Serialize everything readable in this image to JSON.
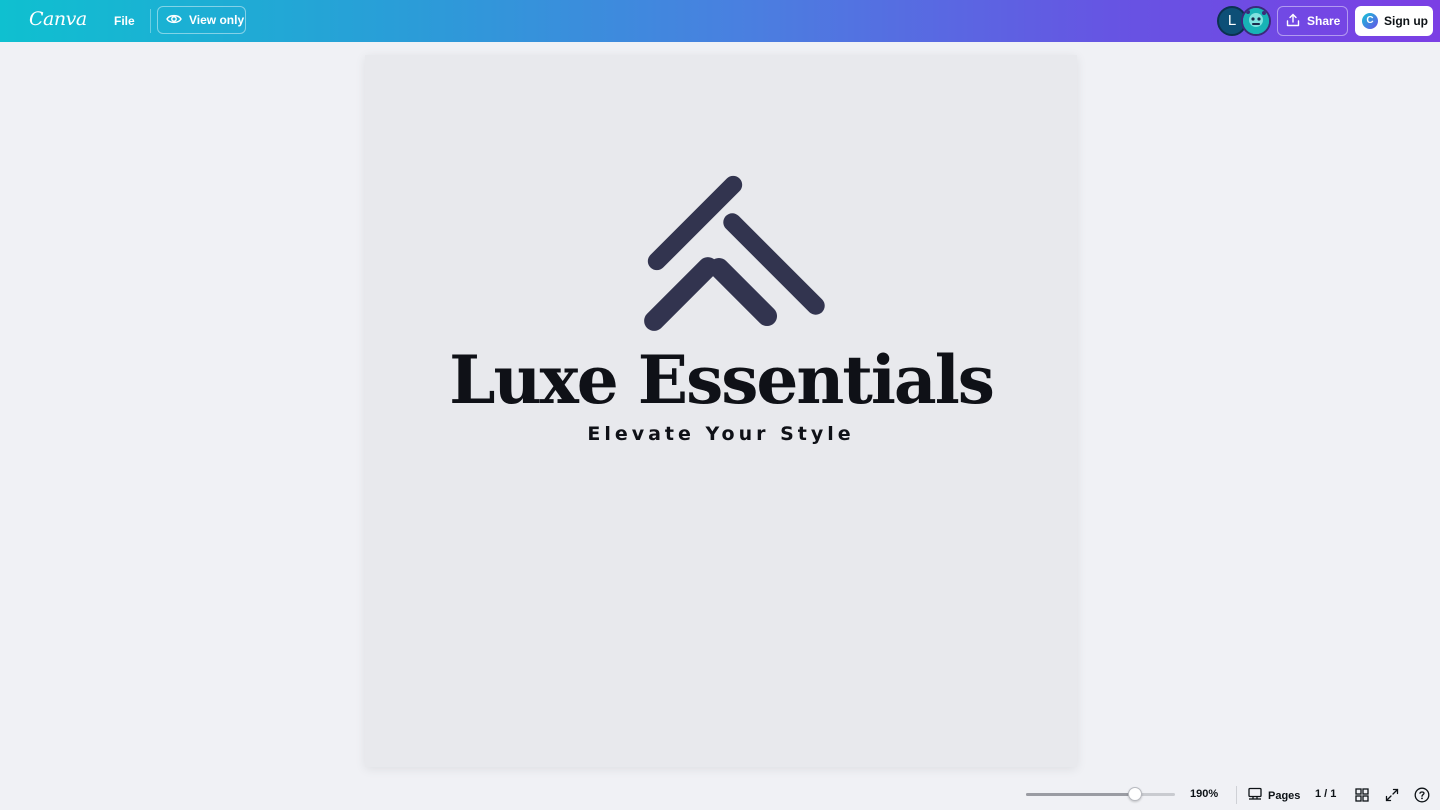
{
  "app": {
    "logo_text": "Canva"
  },
  "header": {
    "file_label": "File",
    "view_only_label": "View only",
    "avatar_initial": "L",
    "share_label": "Share",
    "signup_label": "Sign up",
    "signup_badge": "C"
  },
  "design": {
    "brand_name": "Luxe Essentials",
    "tagline": "Elevate Your Style",
    "mark_color": "#32344f",
    "text_color": "#0f1117",
    "page_background": "#e8e9ed"
  },
  "footer": {
    "zoom_label": "190%",
    "zoom_level": 0.73,
    "pages_label": "Pages",
    "page_count": "1 / 1"
  },
  "icons": {
    "view_only": "eye-icon",
    "share": "upload-icon",
    "pages": "pages-icon",
    "grid": "grid-view-icon",
    "fullscreen": "expand-icon",
    "help": "help-icon"
  },
  "colors": {
    "topbar_start": "#0fc0d0",
    "topbar_end": "#7b3fe4",
    "workspace_background": "#f0f1f5"
  }
}
